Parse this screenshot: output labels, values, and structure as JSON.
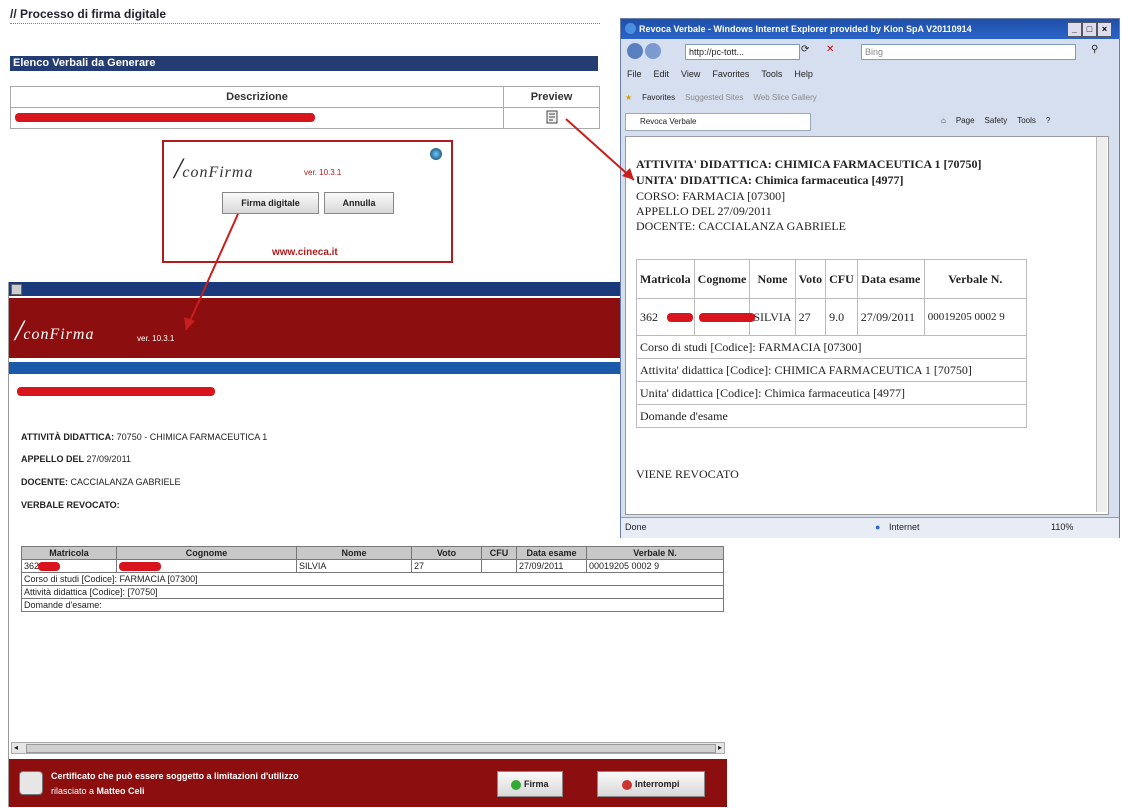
{
  "page": {
    "title": "// Processo di firma digitale",
    "list_title": "Elenco Verbali da Generare",
    "col_descrizione": "Descrizione",
    "col_preview": "Preview"
  },
  "confirma_dialog": {
    "logo_text": "conFirma",
    "version": "ver. 10.3.1",
    "btn_firma": "Firma digitale",
    "btn_annulla": "Annulla",
    "link": "www.cineca.it"
  },
  "applet": {
    "logo_text": "conFirma",
    "version": "ver. 10.3.1",
    "attivita_label": "ATTIVITÀ DIDATTICA:",
    "attivita_value": "70750 - CHIMICA FARMACEUTICA 1",
    "appello_label": "APPELLO DEL",
    "appello_value": "27/09/2011",
    "docente_label": "DOCENTE:",
    "docente_value": "CACCIALANZA GABRIELE",
    "verbale_label": "VERBALE REVOCATO:",
    "table": {
      "headers": [
        "Matricola",
        "Cognome",
        "Nome",
        "Voto",
        "CFU",
        "Data esame",
        "Verbale N."
      ],
      "row": {
        "matricola": "362",
        "nome": "SILVIA",
        "voto": "27",
        "cfu": "",
        "data": "27/09/2011",
        "verbale": "00019205 0002 9"
      },
      "corso": "Corso di studi [Codice]: FARMACIA [07300]",
      "attivita": "Attività didattica [Codice]: [70750]",
      "domande": "Domande d'esame:"
    },
    "footer_line1": "Certificato che può essere soggetto a limitazioni d'utilizzo",
    "footer_line2_prefix": "rilasciato a",
    "footer_line2_name": "Matteo Celi",
    "btn_firma": "Firma",
    "btn_interrompi": "Interrompi"
  },
  "ie": {
    "title": "Revoca Verbale - Windows Internet Explorer provided by Kion SpA V20110914",
    "address": "http://pc-tott...",
    "search": "Bing",
    "menu": [
      "File",
      "Edit",
      "View",
      "Favorites",
      "Tools",
      "Help"
    ],
    "favorites": "Favorites",
    "suggested": "Suggested Sites",
    "gallery": "Web Slice Gallery",
    "tab": "Revoca Verbale",
    "cmd": [
      "Page",
      "Safety",
      "Tools"
    ],
    "content": {
      "line1": "ATTIVITA' DIDATTICA: CHIMICA FARMACEUTICA 1 [70750]",
      "line2": "UNITA' DIDATTICA: Chimica farmaceutica [4977]",
      "line3": "CORSO: FARMACIA [07300]",
      "line4": "APPELLO DEL 27/09/2011",
      "line5": "DOCENTE: CACCIALANZA GABRIELE",
      "headers": [
        "Matricola",
        "Cognome",
        "Nome",
        "Voto",
        "CFU",
        "Data esame",
        "Verbale N."
      ],
      "row": {
        "matricola": "362",
        "nome": "SILVIA",
        "voto": "27",
        "cfu": "9.0",
        "data": "27/09/2011",
        "verbale": "00019205 0002 9"
      },
      "corso": "Corso di studi [Codice]: FARMACIA [07300]",
      "attivita": "Attivita' didattica [Codice]: CHIMICA FARMACEUTICA 1 [70750]",
      "unita": "Unita' didattica [Codice]: Chimica farmaceutica [4977]",
      "domande": "Domande d'esame",
      "footer": "VIENE REVOCATO"
    },
    "status": "Done",
    "zone": "Internet",
    "zoom": "110%"
  },
  "colors": {
    "dark_red": "#8d0e0e",
    "navy": "#1b3a7c",
    "annotation_red": "#c81e1e"
  }
}
